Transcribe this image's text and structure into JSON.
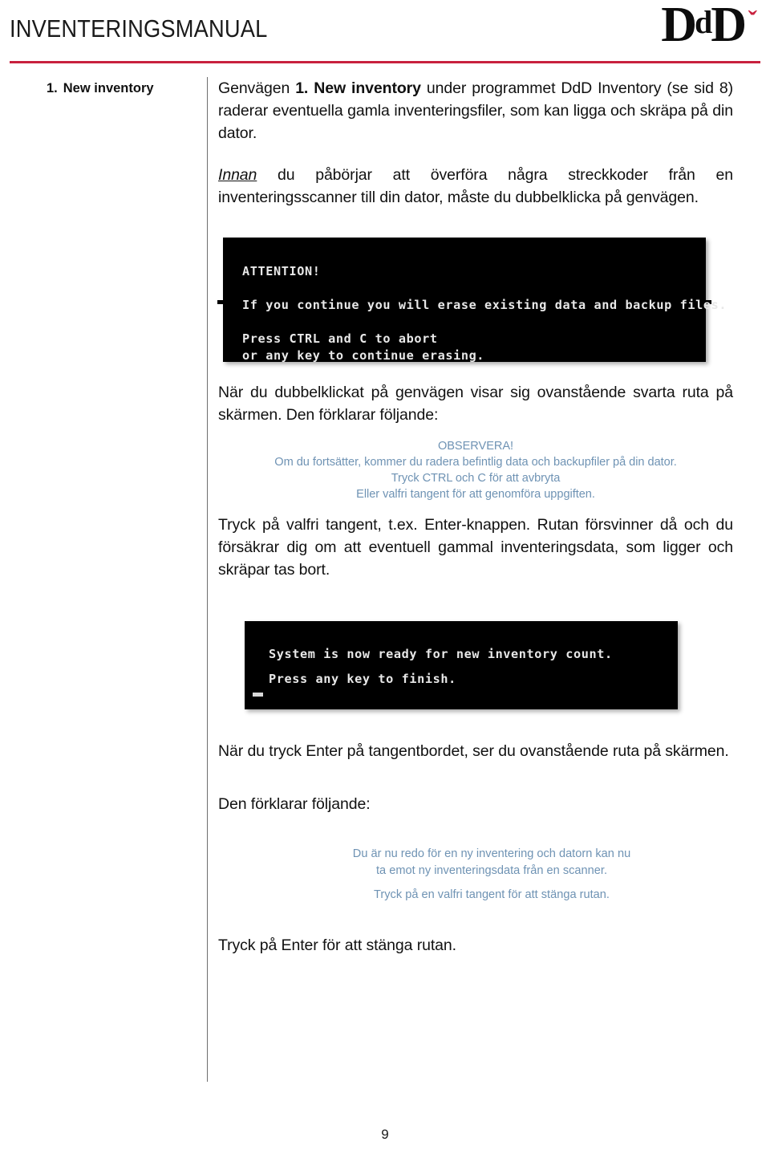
{
  "header": {
    "title": "INVENTERINGSMANUAL",
    "logo": {
      "text_left": "D",
      "text_mid": "d",
      "text_right": "D",
      "caron": "ˇ",
      "accent_color": "#c8213e"
    },
    "rule_color": "#c8213e"
  },
  "sidenote": {
    "number": "1.",
    "label": "New inventory"
  },
  "content": {
    "para1": {
      "seg1": "Genvägen ",
      "bold": "1. New inventory",
      "seg2": " under programmet DdD Inventory (se sid 8) raderar eventuella gamla inventeringsfiler, som kan ligga och skräpa på din dator."
    },
    "para2": {
      "emph": "Innan",
      "rest": " du påbörjar att överföra några streckkoder från en inventeringsscanner till din dator, måste du dubbelklicka på genvägen."
    },
    "para3": "När du dubbelklickat på genvägen visar sig ovanstående svarta ruta på skärmen. Den förklarar följande:",
    "para4": "Tryck på valfri tangent, t.ex. Enter-knappen. Rutan försvinner då och du försäkrar dig om att eventuell gammal inventeringsdata, som ligger och skräpar tas bort.",
    "para5": "När du tryck Enter på tangentbordet, ser du ovanstående ruta på skärmen.",
    "para6": "Den förklarar följande:",
    "para7": "Tryck på Enter för att stänga rutan."
  },
  "terminal1": {
    "line1": "ATTENTION!",
    "line2": "",
    "line3": "If you continue you will erase existing data and backup files.",
    "line4": "",
    "line5": "Press CTRL and C to abort",
    "line6": "or any key to continue erasing."
  },
  "terminal2": {
    "line1": "System is now ready for new inventory count.",
    "line2": "",
    "line3": "Press any key to finish."
  },
  "note1": {
    "color": "#6f93b4",
    "line1": "OBSERVERA!",
    "line2": "Om du fortsätter, kommer du radera befintlig data och backupfiler på din dator.",
    "line3": "Tryck CTRL och C för att avbryta",
    "line4": "Eller valfri tangent för att genomföra uppgiften."
  },
  "note2": {
    "color": "#6f93b4",
    "line1": "Du är nu redo för en ny inventering och datorn kan nu",
    "line2": "ta emot ny inventeringsdata från en scanner.",
    "line3": "Tryck på en valfri tangent för att stänga rutan."
  },
  "footer": {
    "page_number": "9"
  }
}
